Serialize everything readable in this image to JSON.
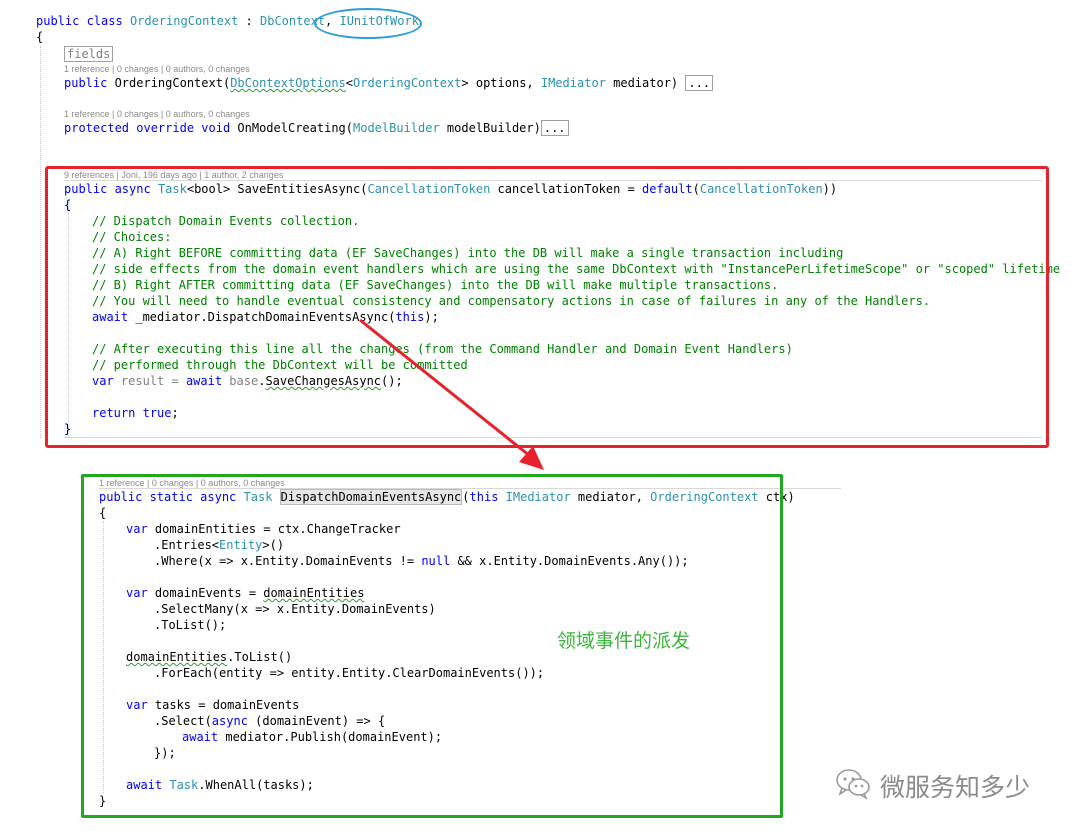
{
  "code_top": {
    "class_decl": {
      "kw": "public class",
      "name": "OrderingContext",
      "colon": " : ",
      "base": "DbContext",
      "comma": ", ",
      "iface": "IUnitOfWork"
    },
    "brace_open": "{",
    "fields_label": "fields",
    "lens_ctor": "1 reference | 0 changes | 0 authors, 0 changes",
    "ctor": {
      "kw": "public",
      "name": " OrderingContext(",
      "t1": "DbContextOptions",
      "lt": "<",
      "t2": "OrderingContext",
      "rest": "> options, ",
      "t3": "IMediator",
      "rest2": " mediator) ",
      "ellipsis": "..."
    },
    "lens_onmodel": "1 reference | 0 changes | 0 authors, 0 changes",
    "onmodel": {
      "kw": "protected override void",
      "name": " OnModelCreating(",
      "t1": "ModelBuilder",
      "rest": " modelBuilder)",
      "ellipsis": "..."
    }
  },
  "save_method": {
    "lens": "9 references | Joni, 196 days ago | 1 author, 2 changes",
    "sig": {
      "kw": "public async",
      "t1": "Task",
      "t2": "<bool>",
      "name": " SaveEntitiesAsync(",
      "t3": "CancellationToken",
      "mid": " cancellationToken = ",
      "kw2": "default",
      "p": "(",
      "t4": "CancellationToken",
      "end": "))"
    },
    "brace_open": "{",
    "comments": [
      "// Dispatch Domain Events collection.",
      "// Choices:",
      "// A) Right BEFORE committing data (EF SaveChanges) into the DB will make a single transaction including",
      "// side effects from the domain event handlers which are using the same DbContext with \"InstancePerLifetimeScope\" or \"scoped\" lifetime",
      "// B) Right AFTER committing data (EF SaveChanges) into the DB will make multiple transactions.",
      "// You will need to handle eventual consistency and compensatory actions in case of failures in any of the Handlers."
    ],
    "await_line": {
      "kw": "await",
      "rest": " _mediator.DispatchDomainEventsAsync(",
      "kw2": "this",
      "end": ");"
    },
    "comments2": [
      "// After executing this line all the changes (from the Command Handler and Domain Event Handlers)",
      "// performed through the DbContext will be committed"
    ],
    "var_line": {
      "kw": "var",
      "name": " result = ",
      "kw2": "await",
      "sp": " ",
      "kw3": "base",
      "dot": ".",
      "call": "SaveChangesAsync",
      "end": "();"
    },
    "return_line": {
      "kw": "return",
      "sp": " ",
      "kw2": "true",
      "end": ";"
    },
    "brace_close": "}"
  },
  "dispatch_method": {
    "lens": "1 reference | 0 changes | 0 authors, 0 changes",
    "sig": {
      "kw": "public static async",
      "t1": "Task",
      "sp": " ",
      "name": "DispatchDomainEventsAsync",
      "p": "(",
      "kw2": "this",
      "sp2": " ",
      "t2": "IMediator",
      "mid": " mediator, ",
      "t3": "OrderingContext",
      "end": " ctx)"
    },
    "brace_open": "{",
    "l1": {
      "kw": "var",
      "rest": " domainEntities = ctx.ChangeTracker"
    },
    "l2": {
      "a": ".Entries<",
      "t": "Entity",
      "b": ">()"
    },
    "l3": {
      "a": ".Where(x => x.Entity.DomainEvents != ",
      "kw": "null",
      "b": " && x.Entity.DomainEvents.Any());"
    },
    "l4": {
      "kw": "var",
      "a": " domainEvents = ",
      "sq": "domainEntities"
    },
    "l5": ".SelectMany(x => x.Entity.DomainEvents)",
    "l6": ".ToList();",
    "l7": {
      "sq": "domainEntities",
      "rest": ".ToList()"
    },
    "l8": ".ForEach(entity => entity.Entity.ClearDomainEvents());",
    "l9": {
      "kw": "var",
      "rest": " tasks = domainEvents"
    },
    "l10": {
      "a": ".Select(",
      "kw": "async",
      "b": " (domainEvent) => {"
    },
    "l11": {
      "kw": "await",
      "rest": " mediator.Publish(domainEvent);"
    },
    "l12": "});",
    "l13": {
      "kw": "await",
      "sp": " ",
      "t": "Task",
      "rest": ".WhenAll(tasks);"
    },
    "brace_close": "}"
  },
  "annotation": {
    "label": "领域事件的派发",
    "color": "#3cb53c"
  },
  "watermark": {
    "label": "微服务知多少",
    "icon": "wechat-icon"
  },
  "colors": {
    "keyword": "#0000ff",
    "type": "#2b91af",
    "comment": "#008000",
    "red_frame": "#e8222b",
    "green_frame": "#21a821",
    "ellipse": "#2d9cdb",
    "arrow": "#e8222b"
  }
}
